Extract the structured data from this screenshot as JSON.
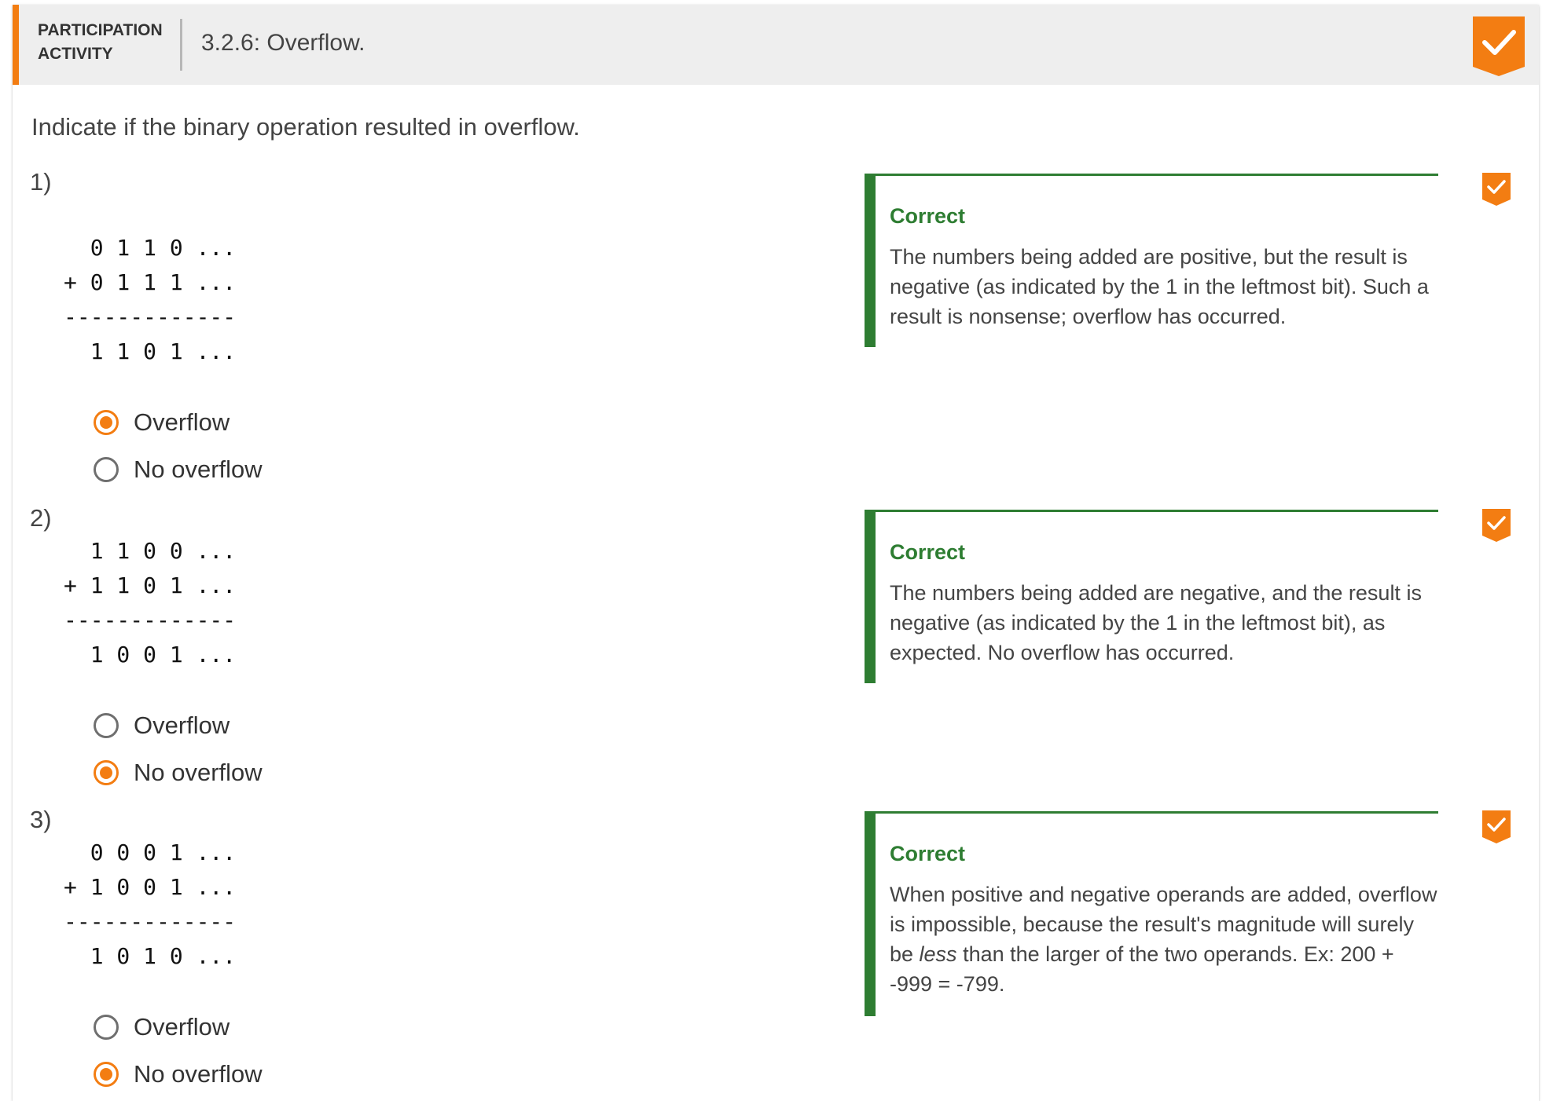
{
  "header": {
    "type_label": "PARTICIPATION ACTIVITY",
    "title": "3.2.6: Overflow.",
    "accent_color": "#f37d12",
    "completion_icon": "check-icon"
  },
  "prompt": "Indicate if the binary operation resulted in overflow.",
  "questions": [
    {
      "number": "1)",
      "arithmetic": "  0 1 1 0 ...\n+ 0 1 1 1 ...\n-------------\n  1 1 0 1 ...",
      "choices": [
        {
          "label": "Overflow",
          "selected": true
        },
        {
          "label": "No overflow",
          "selected": false
        }
      ],
      "feedback_head": "Correct",
      "feedback_text": "The numbers being added are positive, but the result is negative (as indicated by the 1 in the leftmost bit). Such a result is nonsense; overflow has occurred."
    },
    {
      "number": "2)",
      "arithmetic": "  1 1 0 0 ...\n+ 1 1 0 1 ...\n-------------\n  1 0 0 1 ...",
      "choices": [
        {
          "label": "Overflow",
          "selected": false
        },
        {
          "label": "No overflow",
          "selected": true
        }
      ],
      "feedback_head": "Correct",
      "feedback_text": "The numbers being added are negative, and the result is negative (as indicated by the 1 in the leftmost bit), as expected. No overflow has occurred."
    },
    {
      "number": "3)",
      "arithmetic": "  0 0 0 1 ...\n+ 1 0 0 1 ...\n-------------\n  1 0 1 0 ...",
      "choices": [
        {
          "label": "Overflow",
          "selected": false
        },
        {
          "label": "No overflow",
          "selected": true
        }
      ],
      "feedback_head": "Correct",
      "feedback_text_before": "When positive and negative operands are added, overflow is impossible, because the result's magnitude will surely be ",
      "feedback_text_emphasis": "less",
      "feedback_text_after": " than the larger of the two operands. Ex: 200 + -999 = -799."
    }
  ],
  "colors": {
    "accent": "#f37d12",
    "correct": "#2e7d32",
    "header_bg": "#eeeeee"
  }
}
